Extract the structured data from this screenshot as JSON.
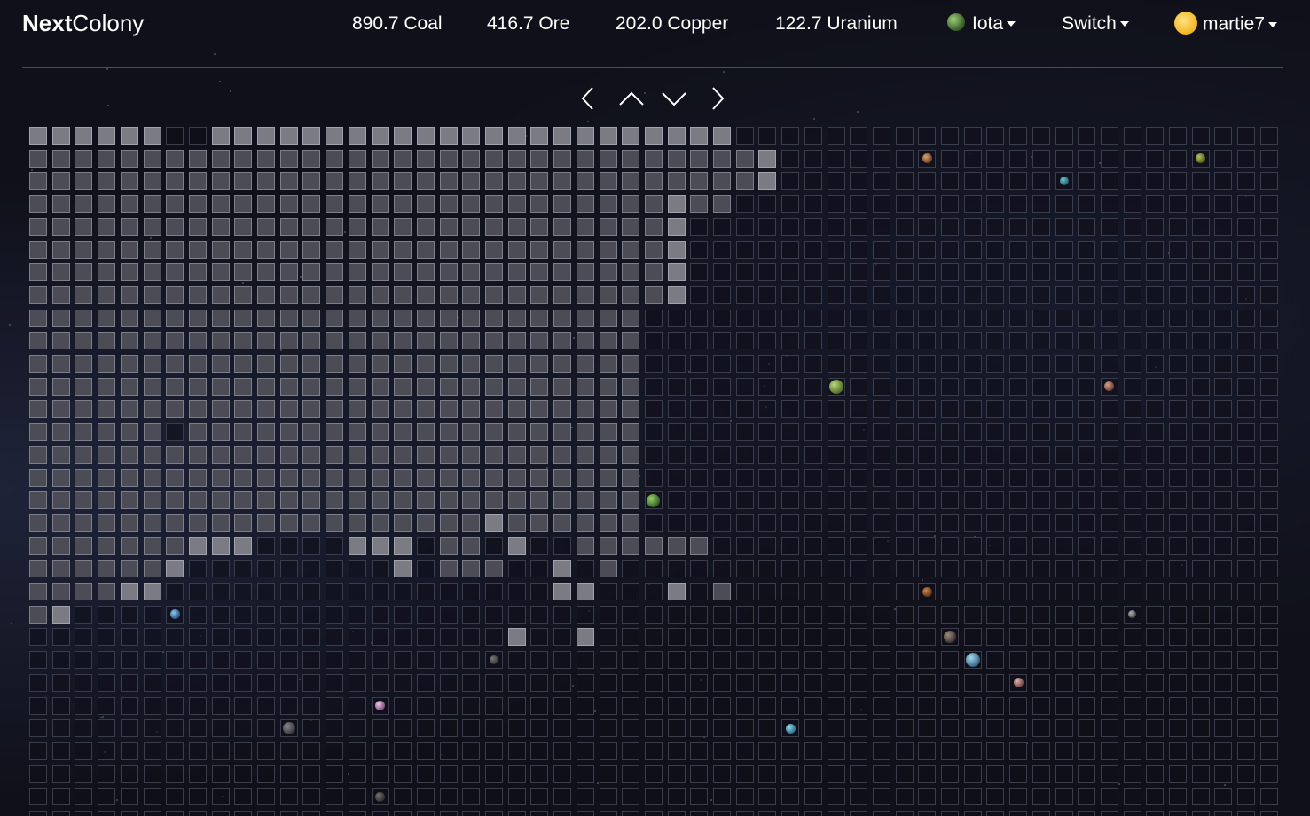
{
  "brand": {
    "bold": "Next",
    "rest": "Colony"
  },
  "resources": [
    "890.7 Coal",
    "416.7 Ore",
    "202.0 Copper",
    "122.7 Uranium"
  ],
  "planet_select": {
    "label": "Iota",
    "icon": "planet-icon"
  },
  "switch_menu": {
    "label": "Switch"
  },
  "user_menu": {
    "label": "martie7",
    "icon": "avatar-icon"
  },
  "map_nav": {
    "left": "chevron-left-icon",
    "up": "chevron-up-icon",
    "down": "chevron-down-icon",
    "right": "chevron-right-icon"
  },
  "colors": {
    "explored_cell": "#4b4c56",
    "highlight_cell": "#7a7b83",
    "unexplored_border": "#3b3d4d"
  }
}
